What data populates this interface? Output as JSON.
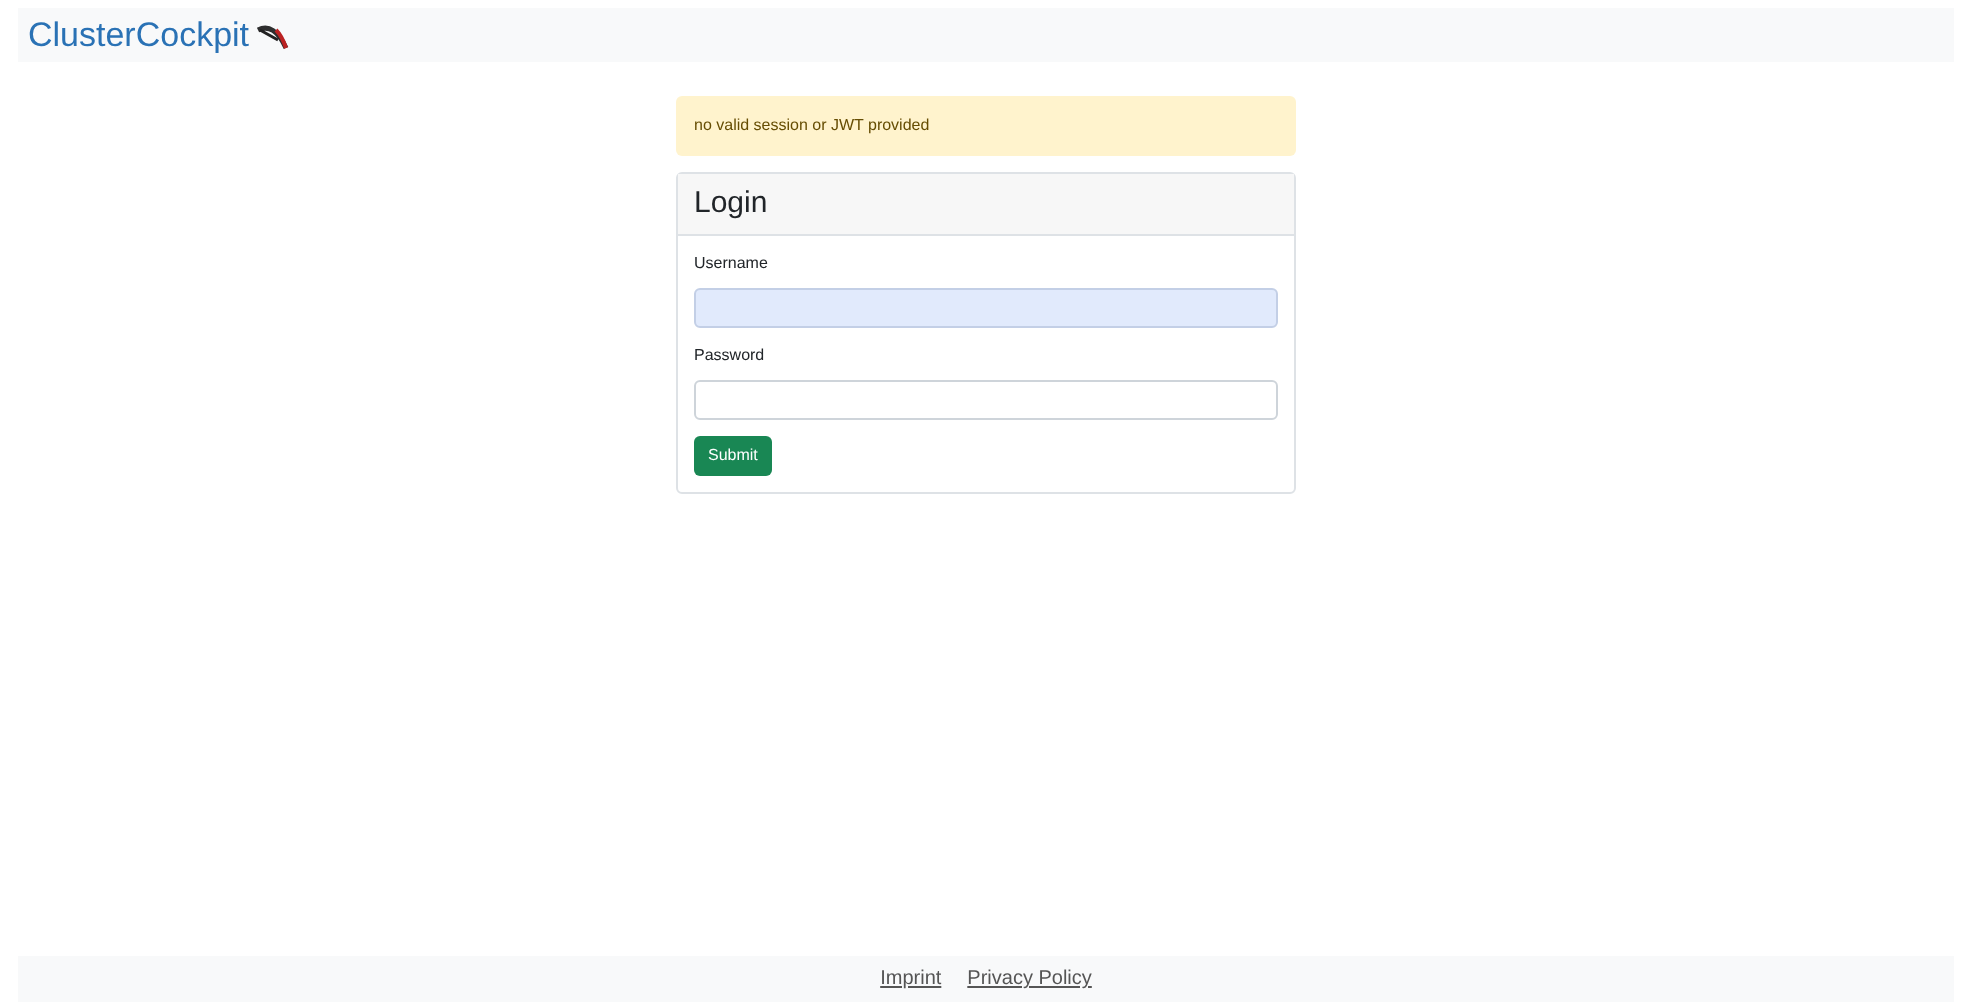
{
  "navbar": {
    "brand": "ClusterCockpit"
  },
  "alert": {
    "text": "no valid session or JWT provided"
  },
  "login": {
    "title": "Login",
    "fields": [
      {
        "label": "Username",
        "autofilled": true
      },
      {
        "label": "Password",
        "autofilled": false
      }
    ],
    "submit": "Submit"
  },
  "footer": {
    "links": [
      "Imprint",
      "Privacy Policy"
    ]
  }
}
